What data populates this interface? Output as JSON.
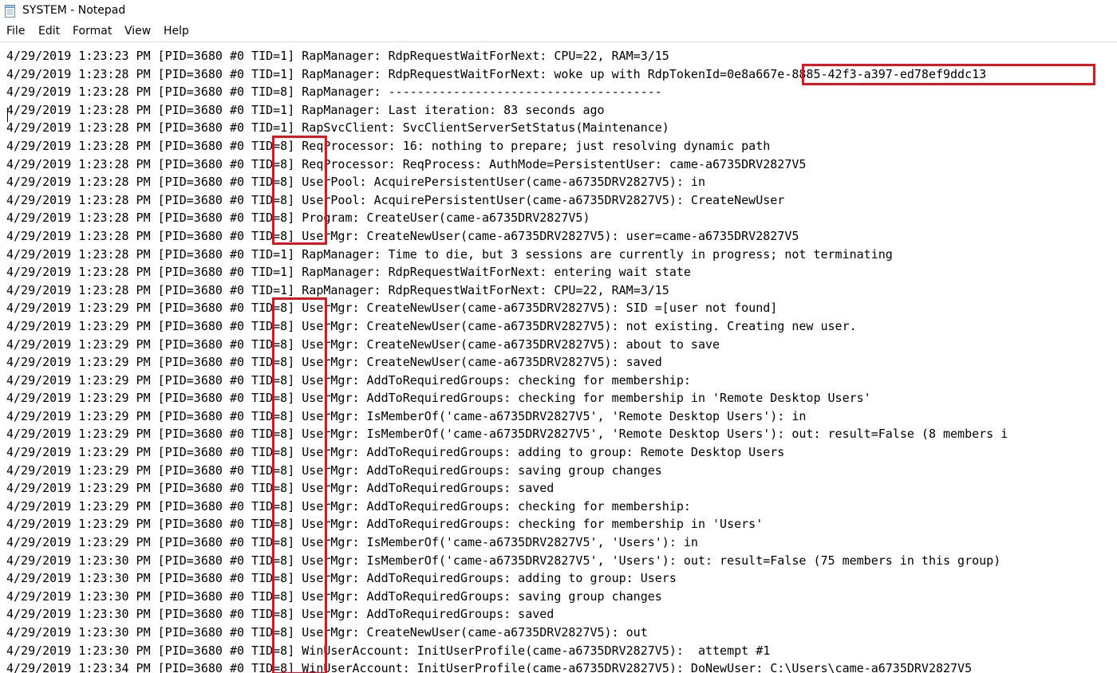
{
  "window": {
    "title": "SYSTEM - Notepad"
  },
  "menu": {
    "items": [
      "File",
      "Edit",
      "Format",
      "View",
      "Help"
    ]
  },
  "editor": {
    "lines": [
      "4/29/2019 1:23:23 PM [PID=3680 #0 TID=1] RapManager: RdpRequestWaitForNext: CPU=22, RAM=3/15",
      "4/29/2019 1:23:28 PM [PID=3680 #0 TID=1] RapManager: RdpRequestWaitForNext: woke up with RdpTokenId=0e8a667e-8885-42f3-a397-ed78ef9ddc13",
      "4/29/2019 1:23:28 PM [PID=3680 #0 TID=8] RapManager: --------------------------------------",
      "4/29/2019 1:23:28 PM [PID=3680 #0 TID=1] RapManager: Last iteration: 83 seconds ago",
      "4/29/2019 1:23:28 PM [PID=3680 #0 TID=1] RapSvcClient: SvcClientServerSetStatus(Maintenance)",
      "4/29/2019 1:23:28 PM [PID=3680 #0 TID=8] ReqProcessor: 16: nothing to prepare; just resolving dynamic path",
      "4/29/2019 1:23:28 PM [PID=3680 #0 TID=8] ReqProcessor: ReqProcess: AuthMode=PersistentUser: came-a6735DRV2827V5",
      "4/29/2019 1:23:28 PM [PID=3680 #0 TID=8] UserPool: AcquirePersistentUser(came-a6735DRV2827V5): in",
      "4/29/2019 1:23:28 PM [PID=3680 #0 TID=8] UserPool: AcquirePersistentUser(came-a6735DRV2827V5): CreateNewUser",
      "4/29/2019 1:23:28 PM [PID=3680 #0 TID=8] Program: CreateUser(came-a6735DRV2827V5)",
      "4/29/2019 1:23:28 PM [PID=3680 #0 TID=8] UserMgr: CreateNewUser(came-a6735DRV2827V5): user=came-a6735DRV2827V5",
      "4/29/2019 1:23:28 PM [PID=3680 #0 TID=1] RapManager: Time to die, but 3 sessions are currently in progress; not terminating",
      "4/29/2019 1:23:28 PM [PID=3680 #0 TID=1] RapManager: RdpRequestWaitForNext: entering wait state",
      "4/29/2019 1:23:28 PM [PID=3680 #0 TID=1] RapManager: RdpRequestWaitForNext: CPU=22, RAM=3/15",
      "4/29/2019 1:23:29 PM [PID=3680 #0 TID=8] UserMgr: CreateNewUser(came-a6735DRV2827V5): SID =[user not found]",
      "4/29/2019 1:23:29 PM [PID=3680 #0 TID=8] UserMgr: CreateNewUser(came-a6735DRV2827V5): not existing. Creating new user.",
      "4/29/2019 1:23:29 PM [PID=3680 #0 TID=8] UserMgr: CreateNewUser(came-a6735DRV2827V5): about to save",
      "4/29/2019 1:23:29 PM [PID=3680 #0 TID=8] UserMgr: CreateNewUser(came-a6735DRV2827V5): saved",
      "4/29/2019 1:23:29 PM [PID=3680 #0 TID=8] UserMgr: AddToRequiredGroups: checking for membership:",
      "4/29/2019 1:23:29 PM [PID=3680 #0 TID=8] UserMgr: AddToRequiredGroups: checking for membership in 'Remote Desktop Users'",
      "4/29/2019 1:23:29 PM [PID=3680 #0 TID=8] UserMgr: IsMemberOf('came-a6735DRV2827V5', 'Remote Desktop Users'): in",
      "4/29/2019 1:23:29 PM [PID=3680 #0 TID=8] UserMgr: IsMemberOf('came-a6735DRV2827V5', 'Remote Desktop Users'): out: result=False (8 members i",
      "4/29/2019 1:23:29 PM [PID=3680 #0 TID=8] UserMgr: AddToRequiredGroups: adding to group: Remote Desktop Users",
      "4/29/2019 1:23:29 PM [PID=3680 #0 TID=8] UserMgr: AddToRequiredGroups: saving group changes",
      "4/29/2019 1:23:29 PM [PID=3680 #0 TID=8] UserMgr: AddToRequiredGroups: saved",
      "4/29/2019 1:23:29 PM [PID=3680 #0 TID=8] UserMgr: AddToRequiredGroups: checking for membership:",
      "4/29/2019 1:23:29 PM [PID=3680 #0 TID=8] UserMgr: AddToRequiredGroups: checking for membership in 'Users'",
      "4/29/2019 1:23:29 PM [PID=3680 #0 TID=8] UserMgr: IsMemberOf('came-a6735DRV2827V5', 'Users'): in",
      "4/29/2019 1:23:30 PM [PID=3680 #0 TID=8] UserMgr: IsMemberOf('came-a6735DRV2827V5', 'Users'): out: result=False (75 members in this group)",
      "4/29/2019 1:23:30 PM [PID=3680 #0 TID=8] UserMgr: AddToRequiredGroups: adding to group: Users",
      "4/29/2019 1:23:30 PM [PID=3680 #0 TID=8] UserMgr: AddToRequiredGroups: saving group changes",
      "4/29/2019 1:23:30 PM [PID=3680 #0 TID=8] UserMgr: AddToRequiredGroups: saved",
      "4/29/2019 1:23:30 PM [PID=3680 #0 TID=8] UserMgr: CreateNewUser(came-a6735DRV2827V5): out",
      "4/29/2019 1:23:30 PM [PID=3680 #0 TID=8] WinUserAccount: InitUserProfile(came-a6735DRV2827V5):  attempt #1",
      "4/29/2019 1:23:34 PM [PID=3680 #0 TID=8] WinUserAccount: InitUserProfile(came-a6735DRV2827V5): DoNewUser: C:\\Users\\came-a6735DRV2827V5"
    ]
  },
  "colors": {
    "highlight": "#e0141e"
  }
}
